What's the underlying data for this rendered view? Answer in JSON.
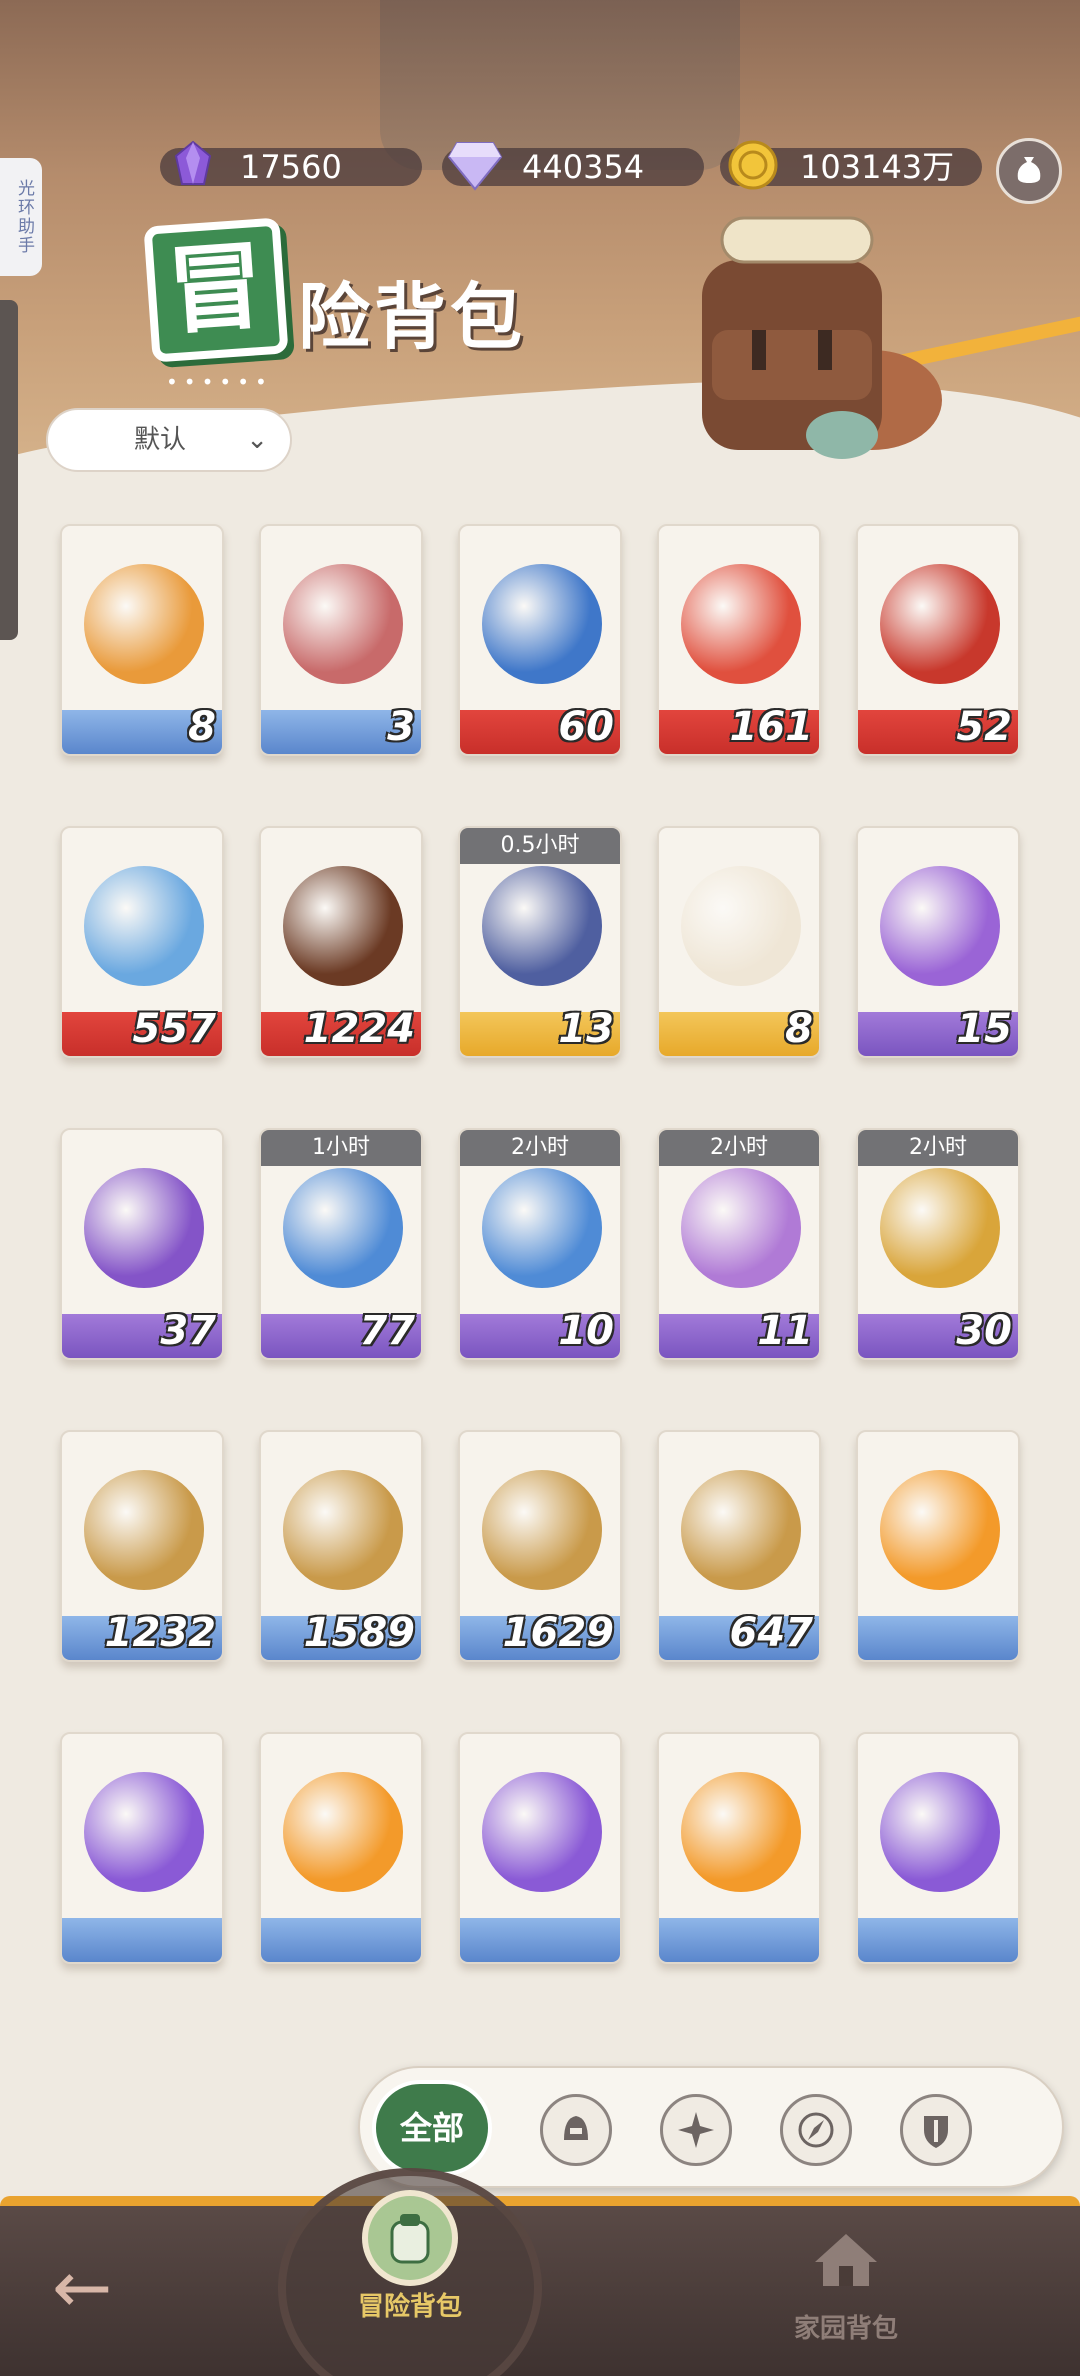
{
  "side_tab": "光环助手",
  "currencies": [
    {
      "icon": "purple-crystal-icon",
      "value": "17560"
    },
    {
      "icon": "diamond-icon",
      "value": "440354"
    },
    {
      "icon": "gold-coin-icon",
      "value": "103143万"
    }
  ],
  "title": {
    "badge": "冒",
    "text": "险背包"
  },
  "sort": {
    "label": "默认"
  },
  "items": [
    {
      "count": "8",
      "band": "blue",
      "art": "#e99a3a",
      "tag": ""
    },
    {
      "count": "3",
      "band": "blue",
      "art": "#c86a6a",
      "tag": ""
    },
    {
      "count": "60",
      "band": "red",
      "art": "#3f77c9",
      "tag": ""
    },
    {
      "count": "161",
      "band": "red",
      "art": "#e0503e",
      "tag": ""
    },
    {
      "count": "52",
      "band": "red",
      "art": "#c8382c",
      "tag": ""
    },
    {
      "count": "557",
      "band": "red",
      "art": "#6aa8e0",
      "tag": ""
    },
    {
      "count": "1224",
      "band": "red",
      "art": "#6b3a24",
      "tag": ""
    },
    {
      "count": "13",
      "band": "gold",
      "art": "#4f5fa0",
      "tag": "0.5小时"
    },
    {
      "count": "8",
      "band": "gold",
      "art": "#efe6d6",
      "tag": ""
    },
    {
      "count": "15",
      "band": "purple",
      "art": "#9a64d6",
      "tag": ""
    },
    {
      "count": "37",
      "band": "purple",
      "art": "#8454c8",
      "tag": ""
    },
    {
      "count": "77",
      "band": "purple",
      "art": "#4f8bd6",
      "tag": "1小时"
    },
    {
      "count": "10",
      "band": "purple",
      "art": "#4f8bd6",
      "tag": "2小时"
    },
    {
      "count": "11",
      "band": "purple",
      "art": "#b07ad6",
      "tag": "2小时"
    },
    {
      "count": "30",
      "band": "purple",
      "art": "#d9a53a",
      "tag": "2小时"
    },
    {
      "count": "1232",
      "band": "blue",
      "art": "#c99a4a",
      "tag": ""
    },
    {
      "count": "1589",
      "band": "blue",
      "art": "#c99a4a",
      "tag": ""
    },
    {
      "count": "1629",
      "band": "blue",
      "art": "#c99a4a",
      "tag": ""
    },
    {
      "count": "647",
      "band": "blue",
      "art": "#c99a4a",
      "tag": ""
    },
    {
      "count": "",
      "band": "blue",
      "art": "#f39a2a",
      "tag": ""
    },
    {
      "count": "",
      "band": "blue",
      "art": "#8a5ad6",
      "tag": ""
    },
    {
      "count": "",
      "band": "blue",
      "art": "#f39a2a",
      "tag": ""
    },
    {
      "count": "",
      "band": "blue",
      "art": "#8a5ad6",
      "tag": ""
    },
    {
      "count": "",
      "band": "blue",
      "art": "#f39a2a",
      "tag": ""
    },
    {
      "count": "",
      "band": "blue",
      "art": "#8a5ad6",
      "tag": ""
    }
  ],
  "filter": {
    "all_label": "全部",
    "icons": [
      "warrior-helmet-icon",
      "compass-star-icon",
      "compass-needle-icon",
      "sword-shield-icon"
    ]
  },
  "nav": {
    "back_icon": "back-arrow-icon",
    "active": {
      "label": "冒险背包",
      "icon": "backpack-icon"
    },
    "inactive": {
      "label": "家园背包",
      "icon": "house-icon"
    }
  },
  "colors": {
    "accent_green": "#3f7b4b",
    "gold": "#e9a32f",
    "band_red": "#d63a33",
    "band_blue": "#7aa0dc",
    "band_gold": "#efb644",
    "band_purple": "#9068cf"
  }
}
